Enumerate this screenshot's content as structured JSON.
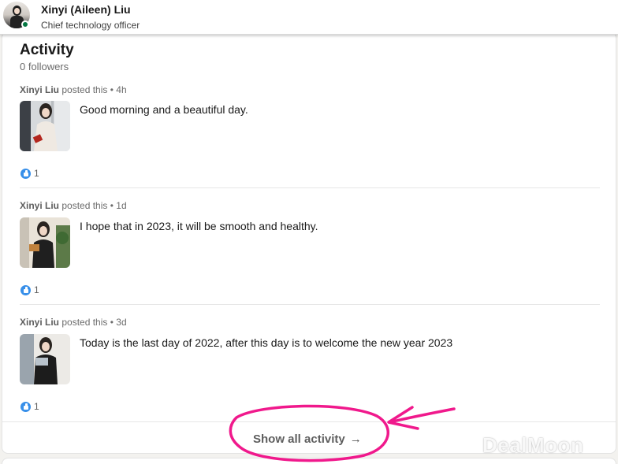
{
  "profile": {
    "name": "Xinyi (Aileen) Liu",
    "headline": "Chief technology officer"
  },
  "activity": {
    "title": "Activity",
    "followers": "0 followers",
    "posts": [
      {
        "author": "Xinyi Liu",
        "meta": "posted this • 4h",
        "text": "Good morning and a beautiful day.",
        "reactions": "1"
      },
      {
        "author": "Xinyi Liu",
        "meta": "posted this • 1d",
        "text": "I hope that in 2023, it will be smooth and healthy.",
        "reactions": "1"
      },
      {
        "author": "Xinyi Liu",
        "meta": "posted this • 3d",
        "text": "Today is the last day of 2022, after this day is to welcome the new year 2023",
        "reactions": "1"
      }
    ],
    "show_all_label": "Show all activity",
    "show_all_arrow": "→"
  },
  "icons": {
    "reaction": "like-icon",
    "arrow": "arrow-right-icon"
  },
  "colors": {
    "annotation": "#f0198c",
    "presence": "#057642",
    "like": "#378fe9"
  },
  "watermark": "DealMoon"
}
